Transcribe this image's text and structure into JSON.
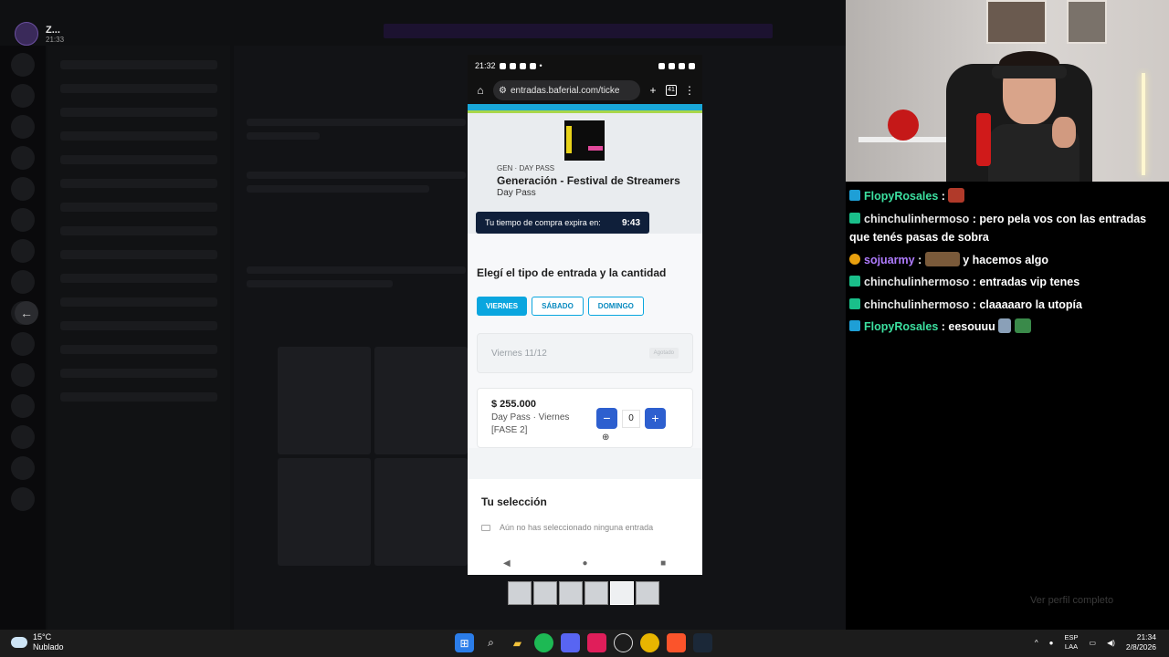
{
  "discord": {
    "user_name": "Z...",
    "user_time": "21:33"
  },
  "phone": {
    "status": {
      "time": "21:32"
    },
    "browser": {
      "url": "entradas.baferial.com/ticke",
      "tab_count": "41"
    },
    "event": {
      "category": "GEN · DAY PASS",
      "title": "Generación - Festival de Streamers",
      "subtitle": "Day Pass",
      "timer_label": "Tu tiempo de compra expira en:",
      "timer_value": "9:43"
    },
    "section_title": "Elegí el tipo de entrada y la cantidad",
    "days": [
      {
        "label": "VIERNES",
        "active": true
      },
      {
        "label": "SÁBADO",
        "active": false
      },
      {
        "label": "DOMINGO",
        "active": false
      }
    ],
    "date_card": {
      "label": "Viernes 11/12",
      "status": "Agotado"
    },
    "ticket": {
      "price": "$ 255.000",
      "desc": "Day Pass · Viernes [FASE 2]",
      "quantity": "0",
      "minus": "−",
      "plus": "+"
    },
    "selection": {
      "title": "Tu selección",
      "empty": "Aún no has seleccionado ninguna entrada"
    }
  },
  "chat": {
    "messages": [
      {
        "user": "FlopyRosales",
        "text": "",
        "badge": "sub",
        "color": "u1"
      },
      {
        "user": "chinchulinhermoso",
        "text": "pero pela vos con las entradas que tenés pasas de sobra",
        "badge": "vip",
        "color": "u2"
      },
      {
        "user": "sojuarmy",
        "text": "y hacemos algo",
        "badge": "gold",
        "color": "u3"
      },
      {
        "user": "chinchulinhermoso",
        "text": "entradas vip tenes",
        "badge": "vip",
        "color": "u2"
      },
      {
        "user": "chinchulinhermoso",
        "text": "claaaaaro la utopía",
        "badge": "vip",
        "color": "u2"
      },
      {
        "user": "FlopyRosales",
        "text": "eesouuu",
        "badge": "sub",
        "color": "u1"
      }
    ],
    "input_placeholder": "Ver perfil completo"
  },
  "taskbar": {
    "temp": "15°C",
    "weather": "Nublado",
    "lang_top": "ESP",
    "lang_bottom": "LAA",
    "time": "21:34",
    "date": "2/8/2026"
  }
}
